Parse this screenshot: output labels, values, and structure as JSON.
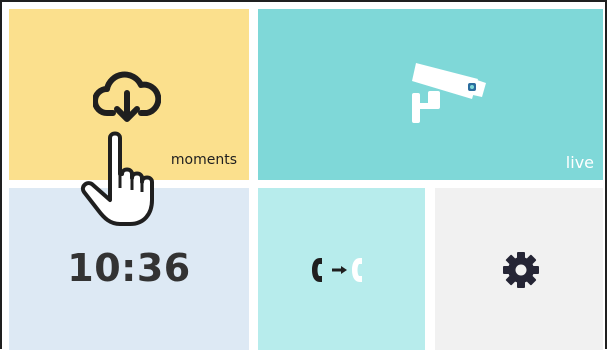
{
  "tiles": {
    "moments": {
      "label": "moments",
      "icon": "cloud-download-icon",
      "color": "#fbe08d"
    },
    "live": {
      "label": "live",
      "icon": "security-camera-icon",
      "color": "#7fd8d8"
    },
    "clock": {
      "time": "10:36",
      "color": "#dde9f4"
    },
    "call_transfer": {
      "icon": "call-transfer-icon",
      "color": "#b7ecec"
    },
    "settings": {
      "icon": "gear-icon",
      "color": "#f1f1f1"
    }
  },
  "overlay": {
    "icon": "hand-pointer-icon"
  }
}
